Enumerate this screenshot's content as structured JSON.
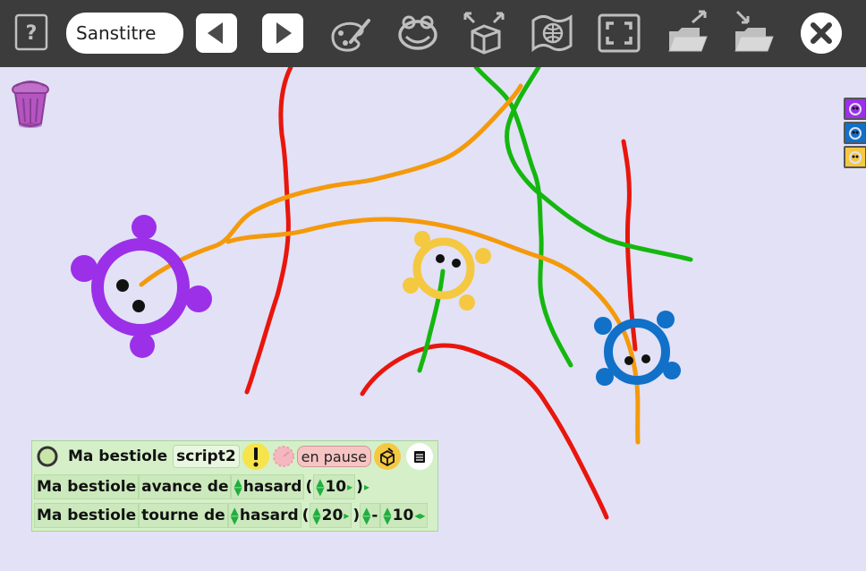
{
  "toolbar": {
    "help_label": "?",
    "title_value": "Sanstitre",
    "buttons": [
      "help-icon",
      "previous-icon",
      "next-icon",
      "paint-icon",
      "frog-icon",
      "network-share-icon",
      "journal-icon",
      "fullscreen-icon",
      "export-icon",
      "import-icon",
      "close-icon"
    ]
  },
  "colors": {
    "toolbar_bg": "#3c3c3c",
    "canvas_bg": "#e2e1f6",
    "purple": "#9b30e8",
    "yellow": "#f5c842",
    "blue": "#1170c8",
    "red": "#e8160c",
    "orange": "#f49a0a",
    "green": "#15b70f",
    "script_bg": "#d5f0c8"
  },
  "sidebar": {
    "thumbnails": [
      {
        "color": "#9b30e8"
      },
      {
        "color": "#1170c8"
      },
      {
        "color": "#f5c842"
      }
    ]
  },
  "script": {
    "sprite_name": "Ma bestiole",
    "script_name": "script2",
    "status": "en pause",
    "lines": [
      {
        "subject": "Ma bestiole",
        "verb": "avance de",
        "func": "hasard",
        "open": "(",
        "arg": "10",
        "close": ")"
      },
      {
        "subject": "Ma bestiole",
        "verb": "tourne de",
        "func": "hasard",
        "open": "(",
        "arg": "20",
        "close": ")",
        "op": "-",
        "arg2": "10"
      }
    ]
  }
}
